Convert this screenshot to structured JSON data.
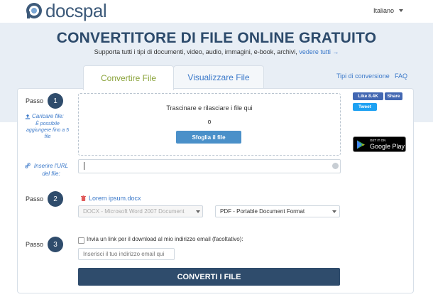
{
  "header": {
    "logo_text": "docspal",
    "language": "Italiano"
  },
  "hero": {
    "title": "CONVERTITORE DI FILE ONLINE GRATUITO",
    "subtitle": "Supporta tutti i tipi di documenti, video, audio, immagini, e-book, archivi,",
    "subtitle_link": "vedere tutti →"
  },
  "tabs": [
    {
      "label": "Convertire File",
      "active": true
    },
    {
      "label": "Visualizzare File",
      "active": false
    }
  ],
  "top_links": {
    "conversion_types": "Tipi di conversione",
    "faq": "FAQ"
  },
  "steps": {
    "step1": {
      "label": "Passo",
      "number": "1"
    },
    "step2": {
      "label": "Passo",
      "number": "2"
    },
    "step3": {
      "label": "Passo",
      "number": "3"
    }
  },
  "upload": {
    "upload_link": "Caricare file:",
    "upload_note": "È possibile aggiungere fino a 5 file",
    "drop_text": "Trascinare e rilasciare i file qui",
    "or_text": "o",
    "browse_button": "Sfoglia il file",
    "url_link": "Inserire l'URL del file:",
    "url_value": ""
  },
  "convert": {
    "file_name": "Lorem ipsum.docx",
    "from_format": "DOCX - Microsoft Word 2007 Document",
    "to_format": "PDF - Portable Document Format"
  },
  "email": {
    "checkbox_label": "Invia un link per il download al mio indirizzo email (facoltativo):",
    "checked": false,
    "placeholder": "Inserisci il tuo indirizzo email qui",
    "convert_button": "CONVERTI I FILE"
  },
  "social": {
    "fb_like": "Like 8.4K",
    "fb_share": "Share",
    "tweet": "Tweet",
    "gplay_small": "GET IT ON",
    "gplay_big": "Google Play"
  },
  "colors": {
    "brand_dark": "#2f4c6c",
    "link_blue": "#3a78c9",
    "tab_active_green": "#8aa33a",
    "band_bg": "#e8eef5",
    "button_blue": "#4a90c9"
  }
}
